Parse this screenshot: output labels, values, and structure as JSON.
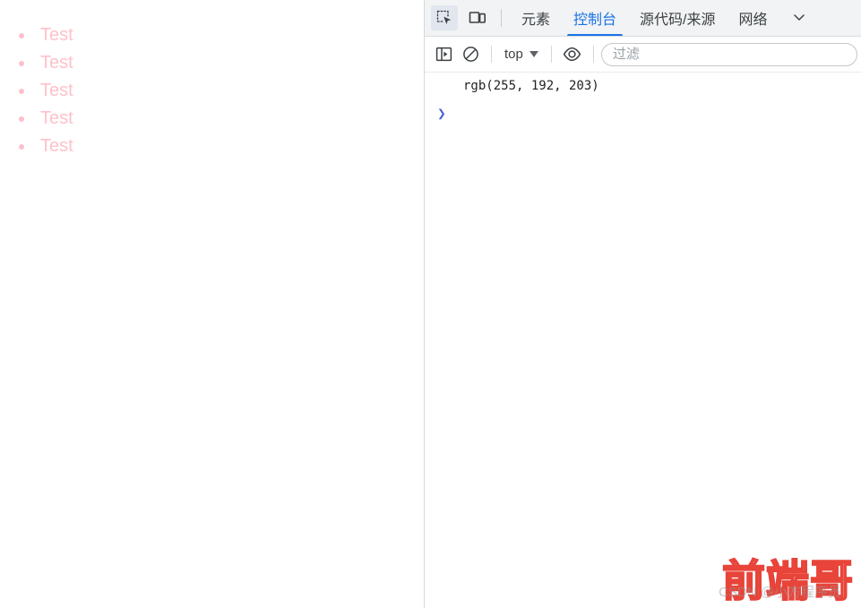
{
  "page": {
    "list_items": [
      {
        "label": "Test"
      },
      {
        "label": "Test"
      },
      {
        "label": "Test"
      },
      {
        "label": "Test"
      },
      {
        "label": "Test"
      }
    ],
    "text_color": "#ffc0cb",
    "bullet_color": "#ffc0cb",
    "background": "#ffffff"
  },
  "devtools": {
    "toolbar": {
      "inspect_icon": "inspect-element-icon",
      "device_icon": "device-toolbar-icon"
    },
    "tabs": [
      {
        "label": "元素",
        "id": "elements",
        "selected": false
      },
      {
        "label": "控制台",
        "id": "console",
        "selected": true
      },
      {
        "label": "源代码/来源",
        "id": "sources",
        "selected": false
      },
      {
        "label": "网络",
        "id": "network",
        "selected": false
      }
    ],
    "accent_color": "#1a73e8",
    "console_controls": {
      "sidebar_icon": "console-sidebar-icon",
      "clear_icon": "clear-console-icon",
      "context_value": "top",
      "eye_icon": "live-expression-eye-icon",
      "filter_placeholder": "过滤",
      "filter_value": ""
    },
    "console_messages": [
      {
        "text": "rgb(255, 192, 203)"
      }
    ],
    "prompt_symbol": "❯",
    "prompt_value": ""
  },
  "watermark": {
    "main_text": "前端哥",
    "sub_text": "CSDN @小方程序员",
    "main_color": "#e8443a"
  }
}
